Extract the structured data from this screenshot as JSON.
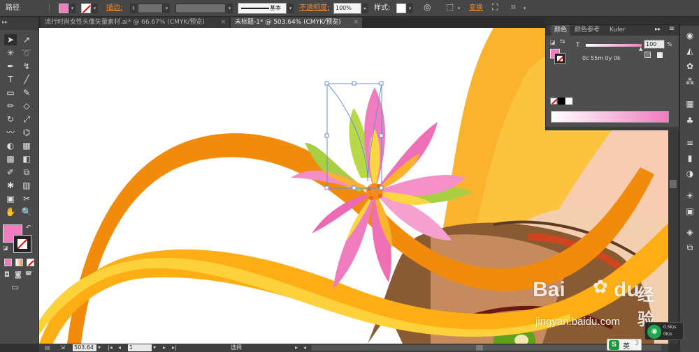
{
  "control_bar": {
    "object_label": "路径",
    "stroke_label": "描边:",
    "stroke_style": "基本",
    "opacity_label": "不透明度:",
    "opacity_value": "100%",
    "style_label": "样式:",
    "transform_label": "变换"
  },
  "tabs": [
    {
      "label": "流行时尚女性头像矢量素材.ai* @ 66.67% (CMYK/预览)",
      "active": false
    },
    {
      "label": "未标题-1* @ 503.64% (CMYK/预览)",
      "active": true
    }
  ],
  "close_glyph": "×",
  "color_panel": {
    "tabs": [
      "颜色",
      "颜色参考",
      "Kuler"
    ],
    "channel_label": "T",
    "tint_value": "100",
    "tint_unit": "%",
    "cmyk_readout": "0c 55m 0y 0k",
    "fill_color": "#f07cc0",
    "menu_glyph": "▸▸",
    "menu_lines": "≡"
  },
  "status_bar": {
    "zoom": "503.64",
    "artboard": "1",
    "tool_name": "选择"
  },
  "watermark": {
    "brand": "Bai",
    "brand2": "du",
    "cn": "经验",
    "url": "jingyan.baidu.com"
  },
  "taskbar": {
    "ime_label": "英",
    "s_icon": "S",
    "net_up": "0.5K/s",
    "net_down": "0K/s"
  },
  "toolbox_icons": [
    "select-tool",
    "direct-select-tool",
    "magic-wand-tool",
    "lasso-tool",
    "pen-tool",
    "curvature-tool",
    "type-tool",
    "line-tool",
    "rectangle-tool",
    "paintbrush-tool",
    "pencil-tool",
    "eraser-tool",
    "rotate-tool",
    "scale-tool",
    "warp-tool",
    "free-transform-tool",
    "shape-builder-tool",
    "perspective-tool",
    "mesh-tool",
    "gradient-tool",
    "eyedropper-tool",
    "blend-tool",
    "symbol-sprayer-tool",
    "column-graph-tool",
    "artboard-tool",
    "slice-tool",
    "hand-tool",
    "zoom-tool"
  ]
}
